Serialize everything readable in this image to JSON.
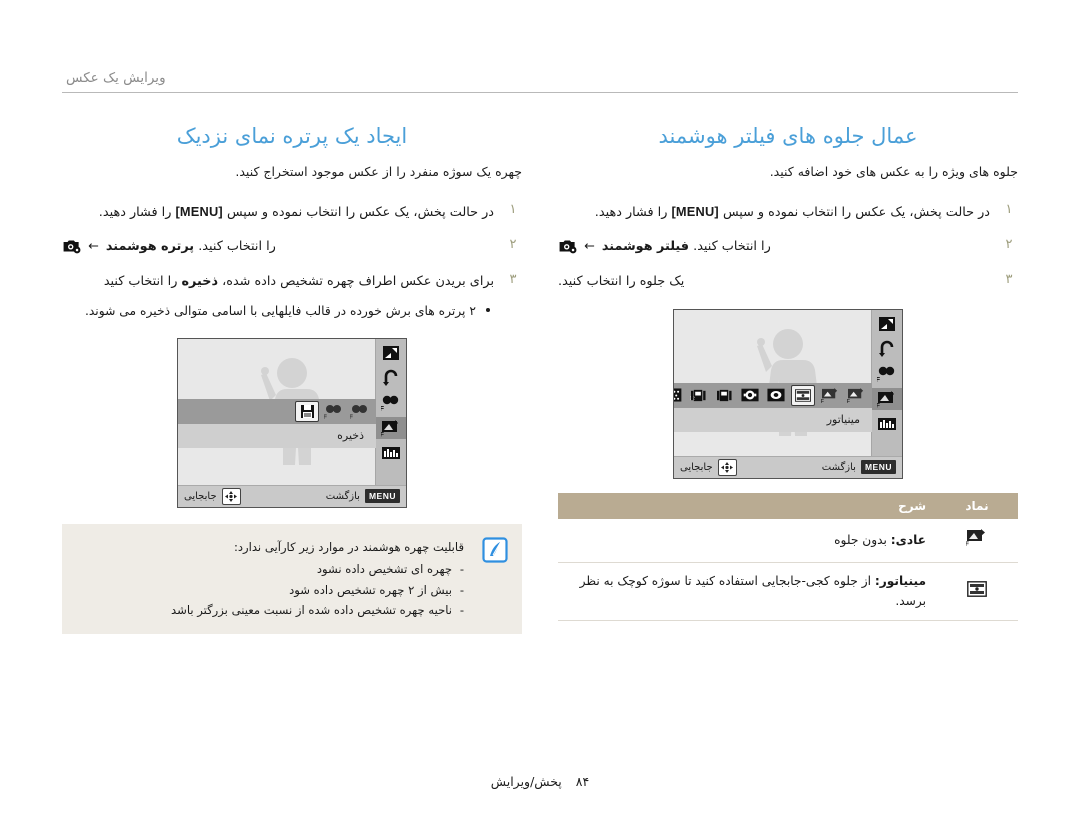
{
  "header": {
    "running_title": "ویرایش یک عکس"
  },
  "right_column": {
    "title": "ایجاد یک پرتره نمای نزدیک",
    "intro": "چهره یک سوژه منفرد را از عکس موجود استخراج کنید.",
    "steps": [
      {
        "num": "۱",
        "text_before": "در حالت پخش، یک عکس را انتخاب نموده و سپس",
        "key": "MENU",
        "text_after": "را فشار دهید."
      },
      {
        "num": "۲",
        "icon": "edit-camera-icon",
        "arrow": "←",
        "bold": "پرتره هوشمند",
        "text_after": "را انتخاب کنید."
      },
      {
        "num": "۳",
        "text_before": "برای بریدن عکس اطراف چهره تشخیص داده شده،",
        "bold": "ذخیره",
        "text_after": "را انتخاب کنید"
      }
    ],
    "substep": "۲ پرتره های برش خورده در قالب فایلهایی با اسامی متوالی ذخیره می شوند.",
    "lcd": {
      "rail_icons": [
        "resize-icon",
        "rotate-icon",
        "retouch-off-icon",
        "smart-filter-off-icon",
        "brightness-icon"
      ],
      "options": [
        "red-eye-off-icon",
        "face-retouch-off-icon",
        "save-icon"
      ],
      "selected_option_index": 2,
      "option_label": "ذخیره",
      "bottom_back_key": "MENU",
      "bottom_back_label": "بازگشت",
      "bottom_move_label": "جابجایی",
      "dpad_icon": "dpad-icon"
    },
    "note": {
      "icon": "note-pen-icon",
      "title": "قابلیت چهره هوشمند در موارد زیر کارآیی ندارد:",
      "items": [
        "چهره ای تشخیص داده نشود",
        "بیش از ۲ چهره تشخیص داده شود",
        "ناحیه چهره تشخیص داده شده از نسبت معینی بزرگتر باشد"
      ]
    }
  },
  "left_column": {
    "title": "عمال جلوه های فیلتر هوشمند",
    "intro": "جلوه های ویژه را به عکس های خود اضافه کنید.",
    "steps": [
      {
        "num": "۱",
        "text_before": "در حالت پخش، یک عکس را انتخاب نموده و سپس",
        "key": "MENU",
        "text_after": "را فشار دهید."
      },
      {
        "num": "۲",
        "icon": "edit-camera-icon",
        "arrow": "←",
        "bold": "فیلتر هوشمند",
        "text_after": "را انتخاب کنید."
      },
      {
        "num": "۳",
        "text_before": "یک جلوه را انتخاب کنید.",
        "bold": "",
        "text_after": ""
      }
    ],
    "lcd": {
      "rail_icons": [
        "resize-icon",
        "rotate-icon",
        "retouch-off-icon",
        "smart-filter-off-icon",
        "brightness-icon"
      ],
      "options": [
        "normal-off-icon",
        "smart-filter-off-icon",
        "miniature-icon",
        "vignetting-icon",
        "soft-focus-icon",
        "old-film1-icon",
        "old-film2-icon",
        "halftone-dot-icon",
        "classic-icon"
      ],
      "selected_option_index": 2,
      "option_label": "مینیاتور",
      "more_glyph": "›",
      "bottom_back_key": "MENU",
      "bottom_back_label": "بازگشت",
      "bottom_move_label": "جابجایی",
      "dpad_icon": "dpad-icon"
    },
    "table": {
      "headers": {
        "icon": "نماد",
        "description": "شرح"
      },
      "rows": [
        {
          "icon": "normal-off-icon",
          "bold": "عادی:",
          "text": "بدون جلوه"
        },
        {
          "icon": "miniature-icon",
          "bold": "مینیاتور:",
          "text": "از جلوه کجی-جابجایی استفاده کنید تا سوژه کوچک به نظر برسد."
        }
      ]
    }
  },
  "footer": {
    "page_number": "۸۴",
    "label": "پخش/ویرایش"
  },
  "colors": {
    "title_blue": "#4a9fd8",
    "table_header": "#b9ab92",
    "note_bg": "#efece6",
    "note_icon": "#2f8fe0",
    "step_number": "#9e9e7e",
    "header_gray": "#8c8c8c"
  }
}
